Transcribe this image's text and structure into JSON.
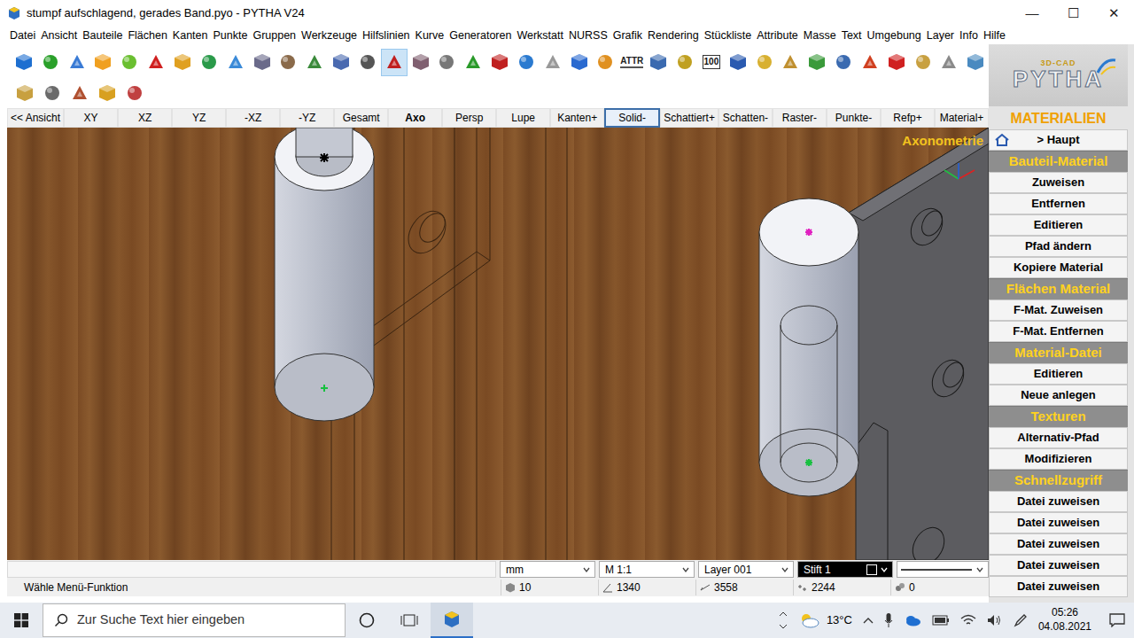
{
  "window": {
    "title": "stumpf aufschlagend, gerades Band.pyo - PYTHA V24",
    "controls": [
      "—",
      "☐",
      "✕"
    ]
  },
  "menu": [
    "Datei",
    "Ansicht",
    "Bauteile",
    "Flächen",
    "Kanten",
    "Punkte",
    "Gruppen",
    "Werkzeuge",
    "Hilfslinien",
    "Kurve",
    "Generatoren",
    "Werkstatt",
    "NURSS",
    "Grafik",
    "Rendering",
    "Stückliste",
    "Attribute",
    "Masse",
    "Text",
    "Umgebung",
    "Layer",
    "Info",
    "Hilfe"
  ],
  "toolbar": {
    "row1": [
      {
        "color": "#1e6fd0",
        "selected": false
      },
      {
        "color": "#2aa02a",
        "selected": false
      },
      {
        "color": "#3a7bd5",
        "selected": false
      },
      {
        "color": "#f0a020",
        "selected": false
      },
      {
        "color": "#6abf30",
        "selected": false
      },
      {
        "color": "#d02020",
        "selected": false
      },
      {
        "color": "#e0a020",
        "selected": false
      },
      {
        "color": "#2a9a4a",
        "selected": false
      },
      {
        "color": "#3a8ad8",
        "selected": false
      },
      {
        "color": "#6a6a8a",
        "selected": false
      },
      {
        "color": "#8a6a4a",
        "selected": false
      },
      {
        "color": "#3a8a3a",
        "selected": false
      },
      {
        "color": "#4a6ab0",
        "selected": false
      },
      {
        "color": "#555555",
        "selected": false
      },
      {
        "color": "#c02020",
        "selected": true
      },
      {
        "color": "#806070",
        "selected": false
      },
      {
        "color": "#777777",
        "selected": false
      },
      {
        "color": "#2a9a2a",
        "selected": false
      },
      {
        "color": "#c02020",
        "selected": false
      },
      {
        "color": "#2a7ad0",
        "selected": false
      },
      {
        "color": "#999999",
        "selected": false
      },
      {
        "color": "#2a6ad0",
        "selected": false
      },
      {
        "color": "#e09020",
        "selected": false
      },
      {
        "label": "ATTR",
        "selected": false
      },
      {
        "color": "#3a6ab0",
        "selected": false
      },
      {
        "color": "#c0a020",
        "selected": false
      },
      {
        "label": "100",
        "selected": false
      },
      {
        "color": "#2a5ab0",
        "selected": false
      },
      {
        "color": "#d8b030",
        "selected": false
      },
      {
        "color": "#c09030",
        "selected": false
      },
      {
        "color": "#3a9a3a",
        "selected": false
      },
      {
        "color": "#3a6ab0",
        "selected": false
      },
      {
        "color": "#d04020",
        "selected": false
      },
      {
        "color": "#d02020",
        "selected": false
      },
      {
        "color": "#c8a040",
        "selected": false
      },
      {
        "color": "#8a8a8a",
        "selected": false
      },
      {
        "color": "#4a8ac0",
        "selected": false
      }
    ],
    "row2": [
      {
        "color": "#c8a040",
        "selected": false
      },
      {
        "color": "#6a6a6a",
        "selected": false
      },
      {
        "color": "#b05030",
        "selected": false
      },
      {
        "color": "#d8a020",
        "selected": false
      },
      {
        "color": "#c04040",
        "selected": false
      }
    ]
  },
  "view_tabs": [
    {
      "label": "<< Ansicht",
      "selected": false,
      "current": false
    },
    {
      "label": "XY",
      "selected": false,
      "current": false
    },
    {
      "label": "XZ",
      "selected": false,
      "current": false
    },
    {
      "label": "YZ",
      "selected": false,
      "current": false
    },
    {
      "label": "-XZ",
      "selected": false,
      "current": false
    },
    {
      "label": "-YZ",
      "selected": false,
      "current": false
    },
    {
      "label": "Gesamt",
      "selected": false,
      "current": false
    },
    {
      "label": "Axo",
      "selected": false,
      "current": true
    },
    {
      "label": "Persp",
      "selected": false,
      "current": false
    },
    {
      "label": "Lupe",
      "selected": false,
      "current": false
    },
    {
      "label": "Kanten+",
      "selected": false,
      "current": false
    },
    {
      "label": "Solid-",
      "selected": true,
      "current": false
    },
    {
      "label": "Schattiert+",
      "selected": false,
      "current": false
    },
    {
      "label": "Schatten-",
      "selected": false,
      "current": false
    },
    {
      "label": "Raster-",
      "selected": false,
      "current": false
    },
    {
      "label": "Punkte-",
      "selected": false,
      "current": false
    },
    {
      "label": "Refp+",
      "selected": false,
      "current": false
    },
    {
      "label": "Material+",
      "selected": false,
      "current": false
    }
  ],
  "viewport": {
    "label": "Axonometrie"
  },
  "side_panel": {
    "logo": "PYTHA",
    "logo_sub": "3D-CAD",
    "items": [
      {
        "label": "MATERIALIEN",
        "kind": "title"
      },
      {
        "label": "> Haupt",
        "kind": "home"
      },
      {
        "label": "Bauteil-Material",
        "kind": "header"
      },
      {
        "label": "Zuweisen",
        "kind": "button"
      },
      {
        "label": "Entfernen",
        "kind": "button"
      },
      {
        "label": "Editieren",
        "kind": "button"
      },
      {
        "label": "Pfad ändern",
        "kind": "button"
      },
      {
        "label": "Kopiere Material",
        "kind": "button"
      },
      {
        "label": "Flächen Material",
        "kind": "header"
      },
      {
        "label": "F-Mat. Zuweisen",
        "kind": "button"
      },
      {
        "label": "F-Mat. Entfernen",
        "kind": "button"
      },
      {
        "label": "Material-Datei",
        "kind": "header"
      },
      {
        "label": "Editieren",
        "kind": "button"
      },
      {
        "label": "Neue anlegen",
        "kind": "button"
      },
      {
        "label": "Texturen",
        "kind": "header"
      },
      {
        "label": "Alternativ-Pfad",
        "kind": "button"
      },
      {
        "label": "Modifizieren",
        "kind": "button"
      },
      {
        "label": "Schnellzugriff",
        "kind": "header"
      },
      {
        "label": "Datei zuweisen",
        "kind": "button"
      },
      {
        "label": "Datei zuweisen",
        "kind": "button"
      },
      {
        "label": "Datei zuweisen",
        "kind": "button"
      },
      {
        "label": "Datei zuweisen",
        "kind": "button"
      },
      {
        "label": "Datei zuweisen",
        "kind": "button"
      }
    ]
  },
  "status_bar": {
    "selectors": [
      {
        "value": "mm",
        "kind": "dropdown"
      },
      {
        "value": "M 1:1",
        "kind": "dropdown"
      },
      {
        "value": "Layer 001",
        "kind": "dropdown"
      },
      {
        "value": "Stift 1",
        "kind": "pen"
      }
    ],
    "message": "Wähle Menü-Funktion",
    "readouts": [
      {
        "value": "10",
        "kind": "count"
      },
      {
        "value": "1340",
        "kind": "angle"
      },
      {
        "value": "3558",
        "kind": "length"
      },
      {
        "value": "2244",
        "kind": "points"
      },
      {
        "value": "0",
        "kind": "groups"
      }
    ]
  },
  "taskbar": {
    "search_placeholder": "Zur Suche Text hier eingeben",
    "app_active": true,
    "weather": "13°C",
    "time": "05:26",
    "date": "04.08.2021"
  }
}
